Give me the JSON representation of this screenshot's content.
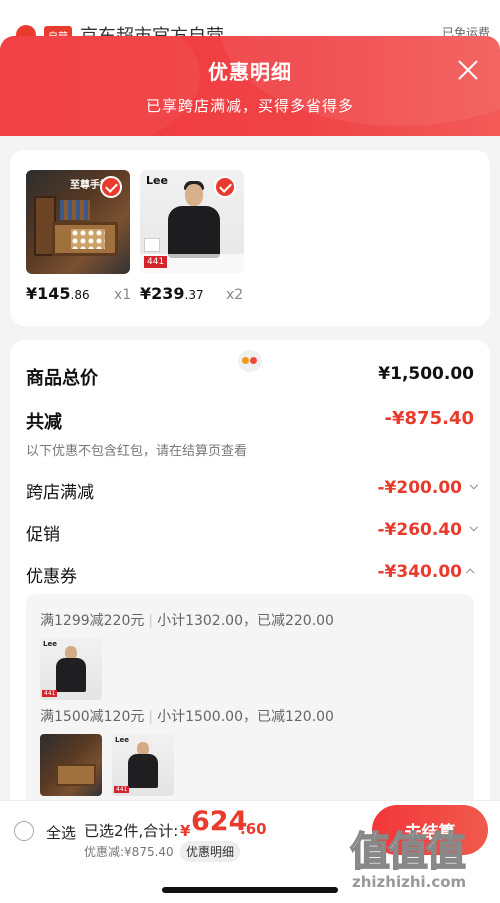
{
  "background": {
    "store_title": "京东超市官方自营",
    "store_tag": "自营",
    "shipping": "已免运费"
  },
  "header": {
    "title": "优惠明细",
    "subtitle": "已享跨店满减，买得多省得多"
  },
  "products": [
    {
      "title": "至尊手提箱",
      "price_int": "¥145",
      "price_dec": ".86",
      "qty": "x1",
      "checked": true
    },
    {
      "brand": "Lee",
      "badge": "441",
      "price_int": "¥239",
      "price_dec": ".37",
      "qty": "x2",
      "checked": true
    }
  ],
  "summary": {
    "total_label": "商品总价",
    "total_value": "¥1,500.00",
    "reduce_label": "共减",
    "reduce_value": "-¥875.40",
    "note": "以下优惠不包含红包，请在结算页查看",
    "items": [
      {
        "label": "跨店满减",
        "value": "-¥200.00"
      },
      {
        "label": "促销",
        "value": "-¥260.40"
      },
      {
        "label": "优惠券",
        "value": "-¥340.00"
      }
    ]
  },
  "coupons": [
    {
      "rule": "满1299减220元",
      "subtotal": "小计1302.00，已减220.00"
    },
    {
      "rule": "满1500减120元",
      "subtotal": "小计1500.00，已减120.00"
    }
  ],
  "thumb_labels": {
    "brand": "Lee",
    "badge": "441"
  },
  "bottom": {
    "select_all": "全选",
    "selected": "已选2件,合计:",
    "currency": "¥",
    "total_int": "624",
    "total_dec": ".60",
    "discount": "优惠减:¥875.40",
    "detail_chip": "优惠明细",
    "checkout": "去结算",
    "watermark": "值值值",
    "watermark_url": "zhizhizhi.com"
  },
  "colors": {
    "accent": "#e93b2d",
    "header_gradient": "#f2363a"
  }
}
